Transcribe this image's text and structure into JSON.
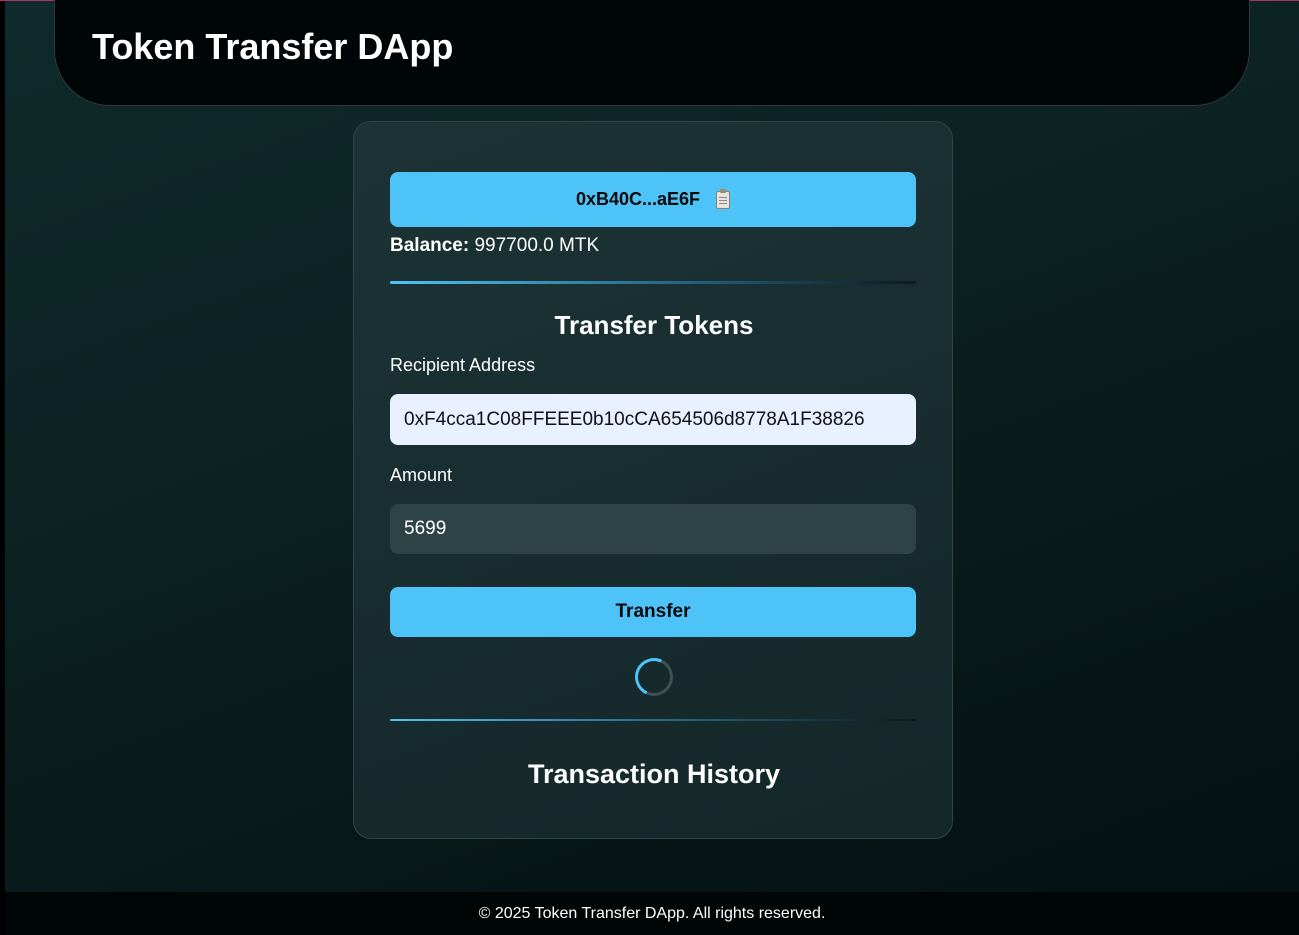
{
  "header": {
    "title": "Token Transfer DApp"
  },
  "wallet": {
    "address_short": "0xB40C...aE6F",
    "copy_icon": "clipboard-icon",
    "balance_label": "Balance:",
    "balance_value": "997700.0 MTK"
  },
  "transfer": {
    "title": "Transfer Tokens",
    "recipient_label": "Recipient Address",
    "recipient_value": "0xF4cca1C08FFEEE0b10cCA654506d8778A1F38826",
    "amount_label": "Amount",
    "amount_value": "5699",
    "button_label": "Transfer",
    "loading": true
  },
  "history": {
    "title": "Transaction History"
  },
  "footer": {
    "text": "© 2025 Token Transfer DApp. All rights reserved."
  },
  "colors": {
    "accent": "#4ec3f7",
    "card_bg": "#1a3033",
    "page_bg": "#0c2324",
    "header_bg": "#000607",
    "recipient_input_bg": "#e9f0ff",
    "amount_input_bg": "#2d4345"
  }
}
